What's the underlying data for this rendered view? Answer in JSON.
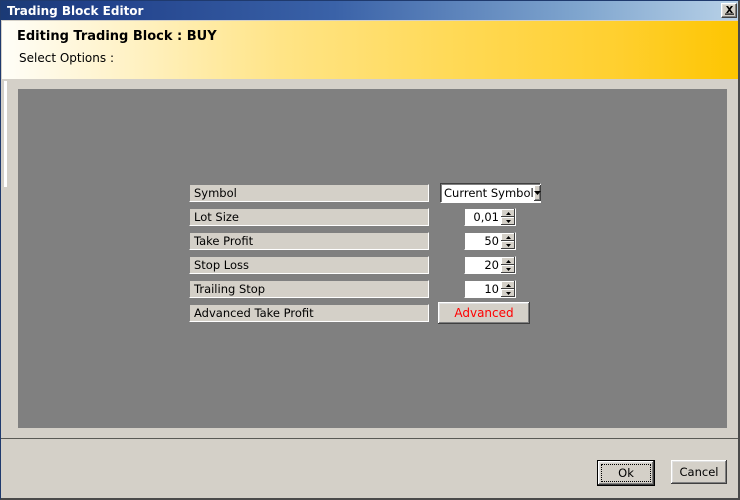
{
  "window": {
    "title": "Trading Block Editor",
    "close_icon": "close-x-icon"
  },
  "banner": {
    "title": "Editing Trading Block : BUY",
    "subtitle": "Select Options :"
  },
  "form": {
    "rows": [
      {
        "label": "Symbol",
        "control": "combo",
        "value": "Current Symbol",
        "arrow_icon": "chevron-down-icon"
      },
      {
        "label": "Lot Size",
        "control": "spinner",
        "value": "0,01"
      },
      {
        "label": "Take Profit",
        "control": "spinner",
        "value": "50"
      },
      {
        "label": "Stop Loss",
        "control": "spinner",
        "value": "20"
      },
      {
        "label": "Trailing Stop",
        "control": "spinner",
        "value": "10"
      },
      {
        "label": "Advanced Take Profit",
        "control": "button",
        "value": "Advanced"
      }
    ]
  },
  "footer": {
    "ok_label": "Ok",
    "cancel_label": "Cancel"
  },
  "colors": {
    "titlebar_start": "#1b3a75",
    "titlebar_end": "#b9d2e8",
    "banner_start": "#fffef8",
    "banner_end": "#fdc500",
    "panel_gray": "#808080",
    "face": "#d4d0c8",
    "advanced_text": "#ff0000"
  }
}
